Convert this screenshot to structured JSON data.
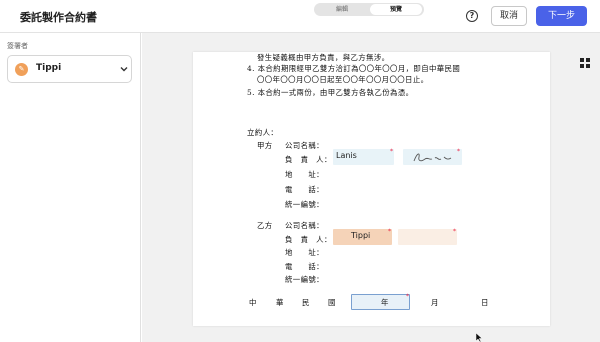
{
  "header": {
    "title": "委託製作合約書",
    "edit_icon": "pencil-icon",
    "help_icon": "help-circle-icon",
    "cancel_label": "取消",
    "next_label": "下一步",
    "accent_color": "#4a62e8"
  },
  "sidebar": {
    "section_label": "簽署者",
    "signer": {
      "name": "Tippi",
      "avatar_color": "#f0a05a",
      "dropdown_icon": "chevron-down-icon"
    }
  },
  "view_toggle": {
    "edit_label": "編輯",
    "preview_label": "預覽",
    "selected": "預覽"
  },
  "document": {
    "lines": [
      "發生疑義概由甲方負責，與乙方無涉。",
      "4. 本合約期限經甲乙雙方洽訂為〇〇年〇〇月，即自中華民國",
      "〇〇年〇〇月〇〇日起至〇〇年〇〇月〇〇日止。",
      "5. 本合約一式兩份，由甲乙雙方各執乙份為憑。"
    ],
    "party_header": "立約人：",
    "party_a": {
      "label": "甲方",
      "company": "公司名稱：",
      "person": "負　責　人：",
      "address": "地　　址：",
      "phone": "電　　話：",
      "tax_id": "統一編號：",
      "name_value": "Lanis"
    },
    "party_b": {
      "label": "乙方",
      "company": "公司名稱：",
      "person": "負　責　人：",
      "address": "地　　址：",
      "phone": "電　　話：",
      "tax_id": "統一編號：",
      "name_value": "Tippi"
    },
    "date_line": {
      "zhong": "中",
      "hua": "華",
      "min": "民",
      "guo": "國",
      "year": "年",
      "month": "月",
      "day": "日"
    },
    "required_mark": "*"
  }
}
